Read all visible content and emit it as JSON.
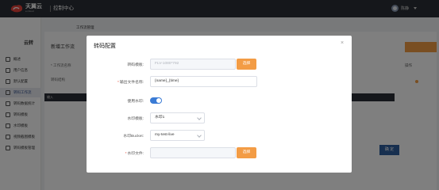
{
  "topbar": {
    "brand": "天翼云",
    "brand_sub": "e-Cloud",
    "console": "控制中心",
    "user": "陈静"
  },
  "sidebar": {
    "title": "云转",
    "items": [
      {
        "label": "概述",
        "active": false
      },
      {
        "label": "用户信息",
        "active": false
      },
      {
        "label": "默认配置",
        "active": false
      },
      {
        "label": "转码工作流",
        "active": true
      },
      {
        "label": "转码数据统计",
        "active": false
      },
      {
        "label": "转码模板",
        "active": false
      },
      {
        "label": "水印模板",
        "active": false
      },
      {
        "label": "视频截图模板",
        "active": false
      },
      {
        "label": "转码模板管理",
        "active": false
      }
    ]
  },
  "background": {
    "breadcrumb": "工作流管理",
    "panel_title": "新增工作流",
    "row_workflow_name": "* 工作流名称",
    "row_transcode": "转码结构",
    "column_action": "操作",
    "bar_label": "输入",
    "confirm_button": "确 定"
  },
  "dialog": {
    "title": "转码配置",
    "close": "×",
    "fields": {
      "template_label": "转码模板:",
      "template_value": "FLV-1080*792",
      "template_button": "选择",
      "output_label": "输出文件名称:",
      "output_value": "{name}_{time}",
      "watermark_toggle_label": "使用水印:",
      "watermark_toggle_on": true,
      "watermark_template_label": "水印模板:",
      "watermark_template_value": "水印1",
      "bucket_label": "水印Bucket:",
      "bucket_value": "my-test-live",
      "watermark_file_label": "水印文件:",
      "watermark_file_value": "",
      "watermark_file_button": "选择"
    }
  },
  "colors": {
    "topbar": "#2b2f36",
    "accent_orange": "#f39c45",
    "toggle_on": "#3a7bd5",
    "required": "#e74c3c"
  }
}
